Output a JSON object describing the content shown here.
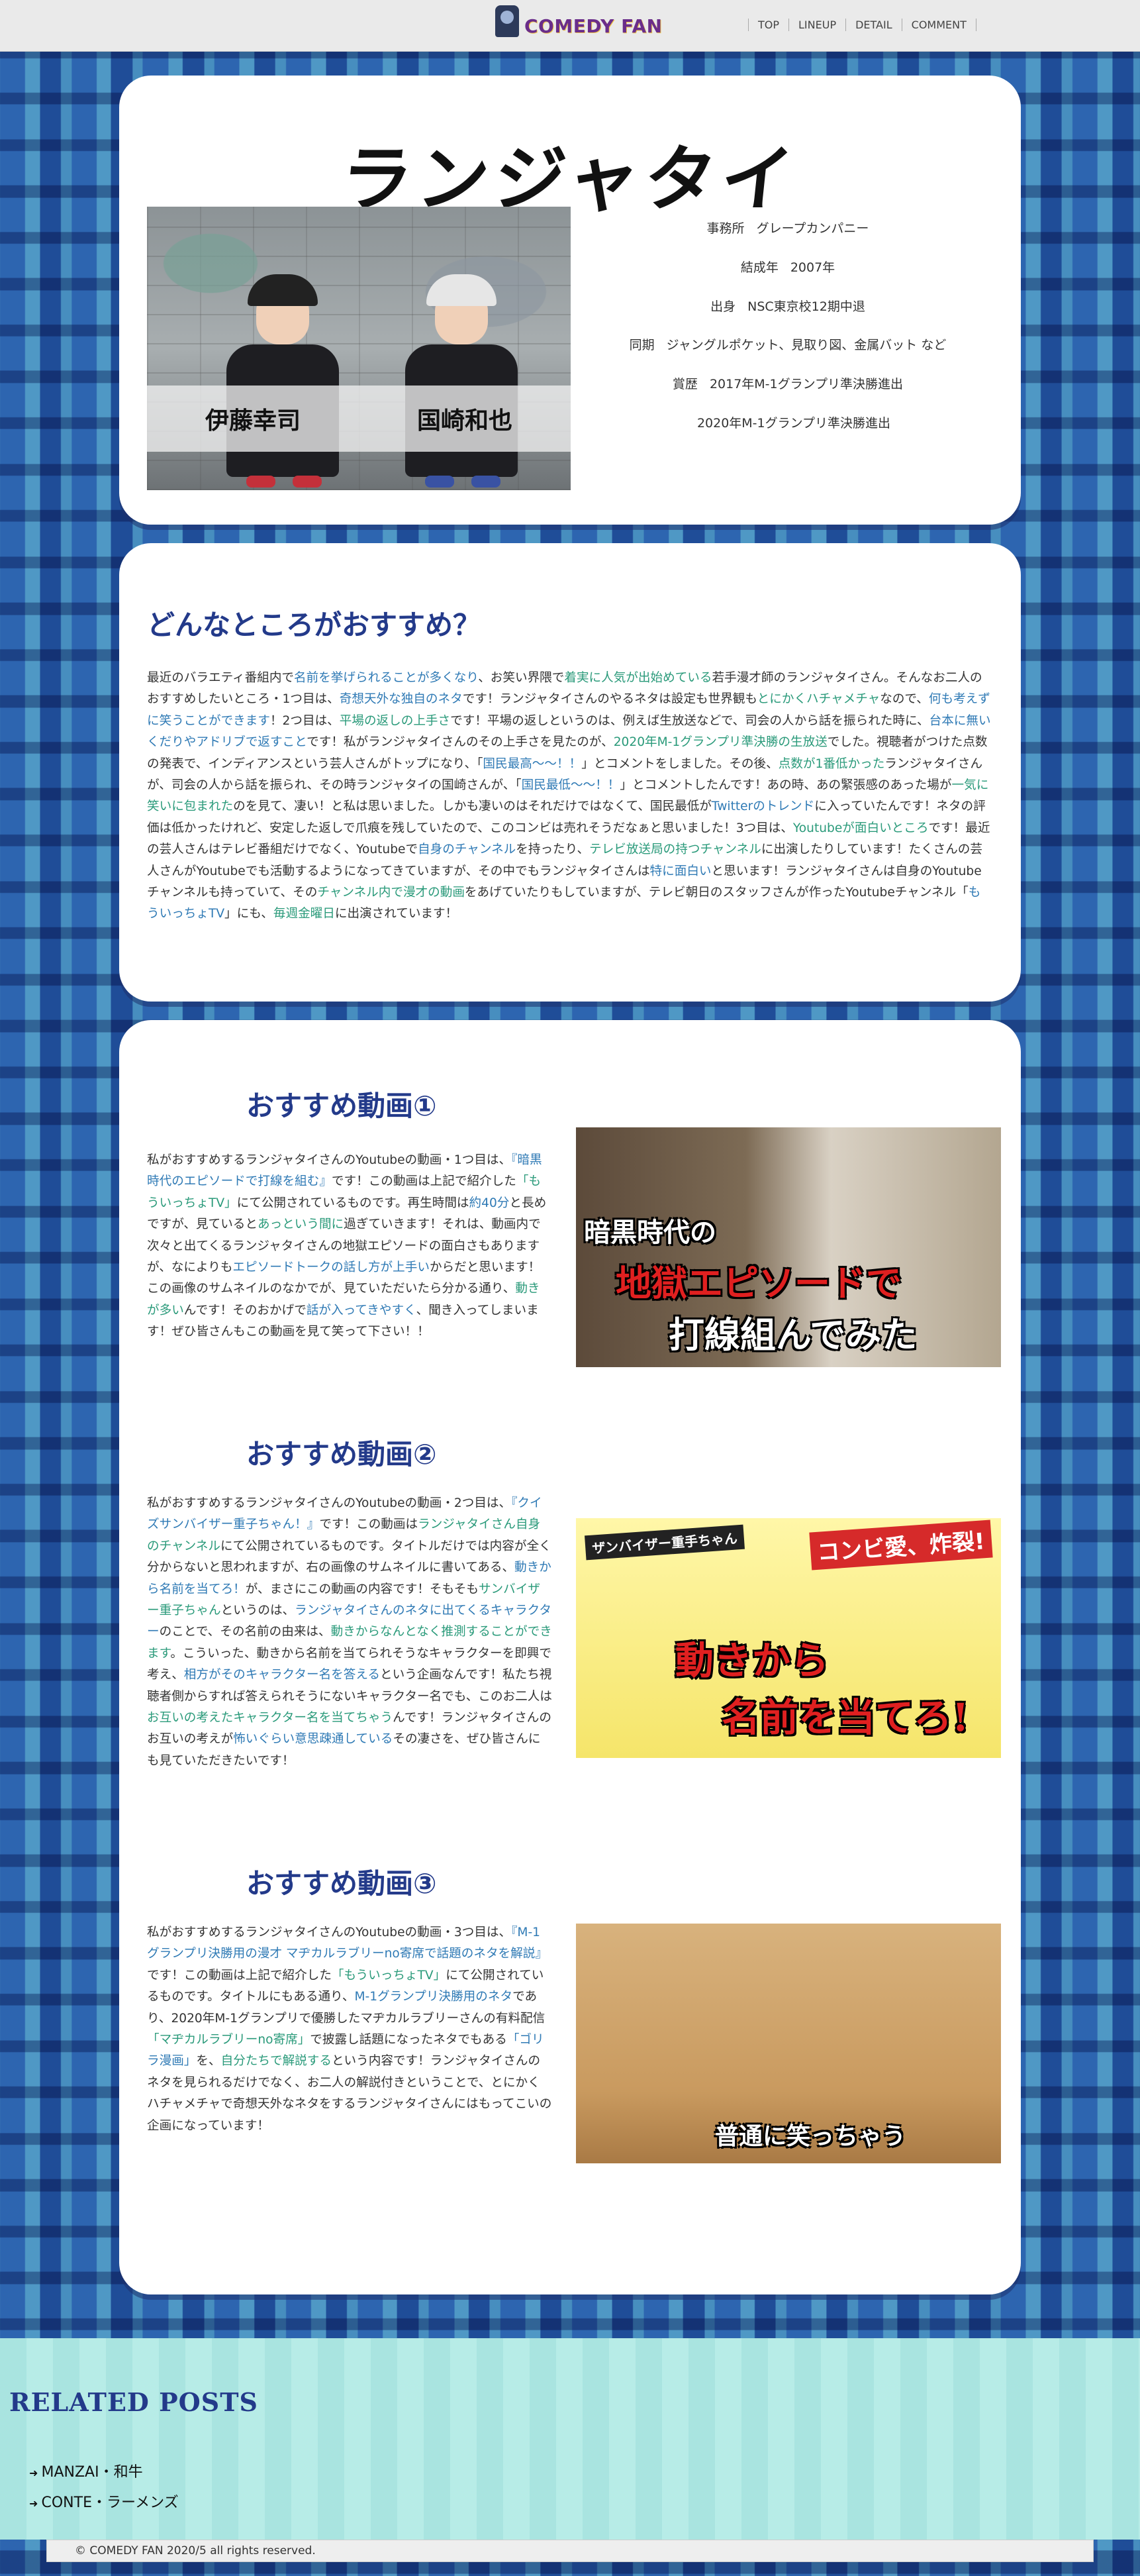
{
  "header": {
    "logo": "COMEDY FAN",
    "nav": [
      "TOP",
      "LINEUP",
      "DETAIL",
      "COMMENT"
    ]
  },
  "profile": {
    "title": "ランジャタイ",
    "members": [
      "伊藤幸司",
      "国崎和也"
    ],
    "rows": [
      {
        "label": "事務所",
        "value": "グレープカンパニー"
      },
      {
        "label": "結成年",
        "value": "2007年"
      },
      {
        "label": "出身",
        "value": "NSC東京校12期中退"
      },
      {
        "label": "同期",
        "value": "ジャングルポケット、見取り図、金属バット など"
      },
      {
        "label": "賞歴",
        "value": "2017年M-1グランプリ準決勝進出"
      },
      {
        "label": "",
        "value": "2020年M-1グランプリ準決勝進出"
      }
    ]
  },
  "recommend": {
    "heading": "どんなところがおすすめ？",
    "body_parts": [
      "最近のバラエティ番組内で",
      "名前を挙げられることが多くなり",
      "、お笑い界隈で",
      "着実に人気が出始めている",
      "若手漫才師のランジャタイさん。そんなお二人のおすすめしたいところ・1つ目は、",
      "奇想天外な独自のネタ",
      "です！ランジャタイさんのやるネタは設定も世界観も",
      "とにかくハチャメチャ",
      "なので、",
      "何も考えずに笑うことができます",
      "！2つ目は、",
      "平場の返しの上手さ",
      "です！平場の返しというのは、例えば生放送などで、司会の人から話を振られた時に、",
      "台本に無いくだりやアドリブで返すこと",
      "です！私がランジャタイさんのその上手さを見たのが、",
      "2020年M-1グランプリ準決勝の生放送",
      "でした。視聴者がつけた点数の発表で、インディアンスという芸人さんがトップになり、「",
      "国民最高～～！！",
      "」とコメントをしました。その後、",
      "点数が1番低かった",
      "ランジャタイさんが、司会の人から話を振られ、その時ランジャタイの国崎さんが、「",
      "国民最低～～！！",
      "」とコメントしたんです！あの時、あの緊張感のあった場が",
      "一気に笑いに包まれた",
      "のを見て、凄い！と私は思いました。しかも凄いのはそれだけではなくて、国民最低が",
      "Twitterのトレンド",
      "に入っていたんです！ネタの評価は低かったけれど、安定した返しで爪痕を残していたので、このコンビは売れそうだなぁと思いました！3つ目は、",
      "Youtubeが面白いところ",
      "です！最近の芸人さんはテレビ番組だけでなく、Youtubeで",
      "自身のチャンネル",
      "を持ったり、",
      "テレビ放送局の持つチャンネル",
      "に出演したりしています！たくさんの芸人さんがYoutubeでも活動するようになってきていますが、その中でもランジャタイさんは",
      "特に面白い",
      "と思います！ランジャタイさんは自身のYoutubeチャンネルも持っていて、その",
      "チャンネル内で漫才の動画",
      "をあげていたりもしていますが、テレビ朝日のスタッフさんが作ったYoutubeチャンネル「",
      "もういっちょTV",
      "」にも、",
      "毎週金曜日",
      "に出演されています！"
    ]
  },
  "videos": [
    {
      "heading": "おすすめ動画①",
      "thumb_lines": [
        "暗黒時代の",
        "地獄エピソードで",
        "打線組んでみた"
      ],
      "body_parts": [
        "私がおすすめするランジャタイさんのYoutubeの動画・1つ目は、",
        "『暗黒時代のエピソードで打線を組む』",
        "です！この動画は上記で紹介した",
        "「もういっちょTV」",
        "にて公開されているものです。再生時間は",
        "約40分",
        "と長めですが、見ていると",
        "あっという間に",
        "過ぎていきます！それは、動画内で次々と出てくるランジャタイさんの地獄エピソードの面白さもありますが、なによりも",
        "エピソードトークの話し方が上手い",
        "からだと思います！この画像のサムネイルのなかでが、見ていただいたら分かる通り、",
        "動きが多い",
        "んです！そのおかげで",
        "話が入ってきやすく",
        "、聞き入ってしまいます！ぜひ皆さんもこの動画を見て笑って下さい！！"
      ]
    },
    {
      "heading": "おすすめ動画②",
      "thumb_lines": [
        "ザンバイザー重手ちゃん",
        "コンビ愛、炸裂!",
        "動きから",
        "名前を当てろ!"
      ],
      "body_parts": [
        "私がおすすめするランジャタイさんのYoutubeの動画・2つ目は、",
        "『クイズサンバイザー重子ちゃん！』",
        "です！この動画は",
        "ランジャタイさん自身のチャンネル",
        "にて公開されているものです。タイトルだけでは内容が全く分からないと思われますが、右の画像のサムネイルに書いてある、",
        "動きから名前を当てろ！",
        "が、まさにこの動画の内容です！そもそも",
        "サンバイザー重子ちゃん",
        "というのは、",
        "ランジャタイさんのネタに出てくるキャラクター",
        "のことで、その名前の由来は、",
        "動きからなんとなく推測することができます",
        "。こういった、動きから名前を当てられそうなキャラクターを即興で考え、",
        "相方がそのキャラクター名を答える",
        "という企画なんです！私たち視聴者側からすれば答えられそうにないキャラクター名でも、このお二人は",
        "お互いの考えたキャラクター名を当てちゃう",
        "んです！ランジャタイさんのお互いの考えが",
        "怖いぐらい意思疎通している",
        "その凄さを、ぜひ皆さんにも見ていただきたいです！"
      ]
    },
    {
      "heading": "おすすめ動画③",
      "thumb_lines": [
        "普通に笑っちゃう"
      ],
      "body_parts": [
        "私がおすすめするランジャタイさんのYoutubeの動画・3つ目は、",
        "『M-1グランプリ決勝用の漫才 マヂカルラブリーno寄席で話題のネタを解説』",
        "です！この動画は上記で紹介した",
        "「もういっちょTV」",
        "にて公開されているものです。タイトルにもある通り、",
        "M-1グランプリ決勝用のネタ",
        "であり、2020年M-1グランプリで優勝したマヂカルラブリーさんの有料配信",
        "「マヂカルラブリーno寄席」",
        "で披露し話題になったネタでもある",
        "「ゴリラ漫画」",
        "を、",
        "自分たちで解説する",
        "という内容です！ランジャタイさんのネタを見られるだけでなく、お二人の解説付きということで、とにかくハチャメチャで奇想天外なネタをするランジャタイさんにはもってこいの企画になっています！"
      ]
    }
  ],
  "related": {
    "heading": "RELATED POSTS",
    "items": [
      "MANZAI・和牛",
      "CONTE・ラーメンズ"
    ]
  },
  "footer": {
    "copyright": "© COMEDY FAN 2020/5 all rights reserved."
  },
  "colors": {
    "accent": "#233a8a",
    "link_blue": "#2f7ab5",
    "link_green": "#2a9a7a"
  }
}
